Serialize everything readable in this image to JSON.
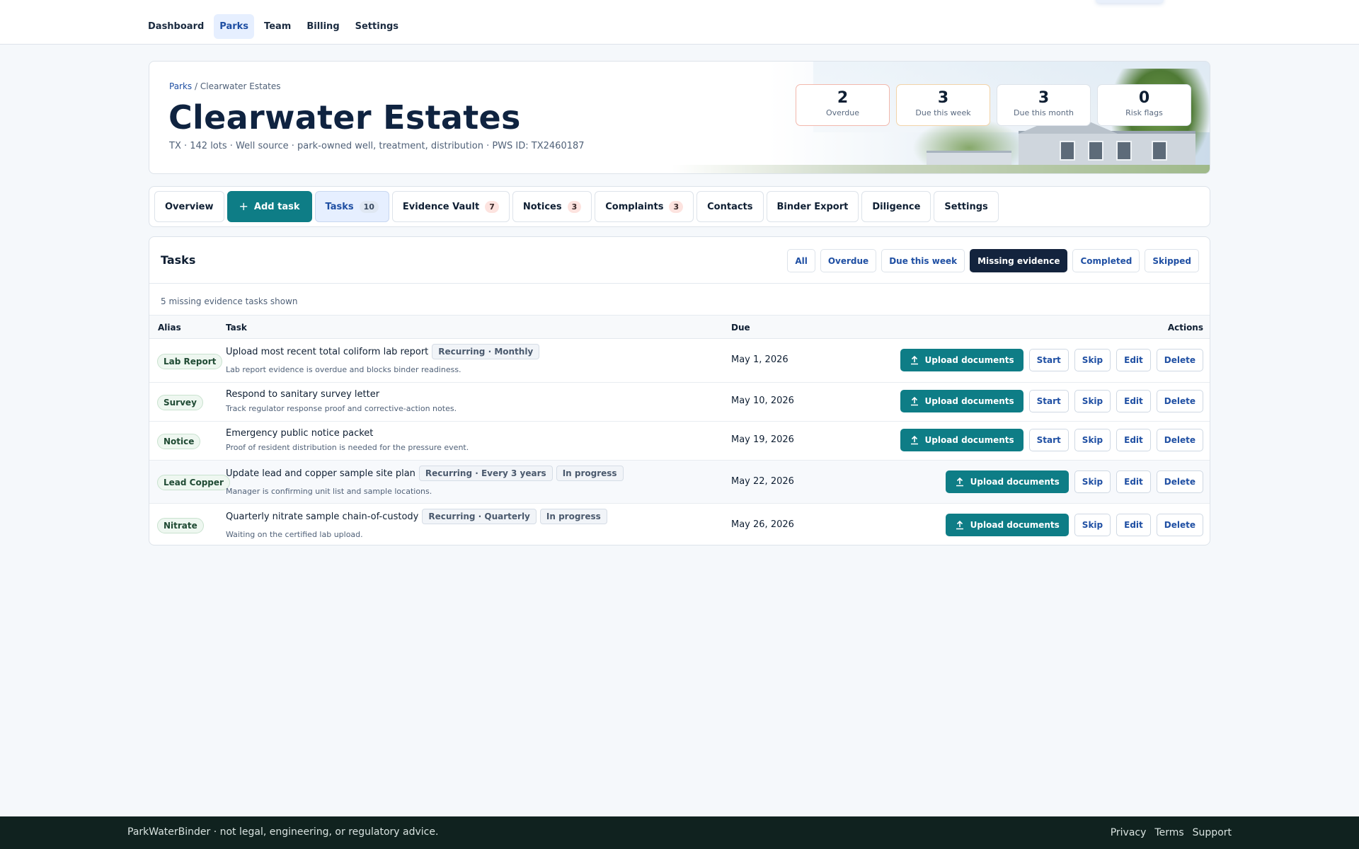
{
  "nav": {
    "items": [
      {
        "label": "Dashboard",
        "active": false
      },
      {
        "label": "Parks",
        "active": true
      },
      {
        "label": "Team",
        "active": false
      },
      {
        "label": "Billing",
        "active": false
      },
      {
        "label": "Settings",
        "active": false
      }
    ]
  },
  "hero": {
    "breadcrumb": {
      "root": "Parks",
      "sep": "/",
      "current": "Clearwater Estates"
    },
    "title": "Clearwater Estates",
    "meta": "TX · 142 lots · Well source · park-owned well, treatment, distribution · PWS ID: TX2460187",
    "stats": [
      {
        "value": "2",
        "label": "Overdue"
      },
      {
        "value": "3",
        "label": "Due this week"
      },
      {
        "value": "3",
        "label": "Due this month"
      },
      {
        "value": "0",
        "label": "Risk flags"
      }
    ]
  },
  "tabs": {
    "overview": "Overview",
    "add_task": "Add task",
    "tasks": {
      "label": "Tasks",
      "badge": "10"
    },
    "evidence": {
      "label": "Evidence Vault",
      "badge": "7"
    },
    "notices": {
      "label": "Notices",
      "badge": "3"
    },
    "complaints": {
      "label": "Complaints",
      "badge": "3"
    },
    "contacts": "Contacts",
    "binder": "Binder Export",
    "diligence": "Diligence",
    "settings": "Settings"
  },
  "tasks_panel": {
    "title": "Tasks",
    "filters": [
      "All",
      "Overdue",
      "Due this week",
      "Missing evidence",
      "Completed",
      "Skipped"
    ],
    "active_filter": "Missing evidence",
    "count_text": "5 missing evidence tasks shown",
    "columns": {
      "alias": "Alias",
      "task": "Task",
      "due": "Due",
      "actions": "Actions"
    },
    "action_labels": {
      "upload": "Upload documents",
      "start": "Start",
      "skip": "Skip",
      "edit": "Edit",
      "delete": "Delete"
    },
    "rows": [
      {
        "alias": "Lab Report",
        "title": "Upload most recent total coliform lab report",
        "tags": [
          "Recurring · Monthly"
        ],
        "desc": "Lab report evidence is overdue and blocks binder readiness.",
        "due": "May 1, 2026",
        "has_start": true
      },
      {
        "alias": "Survey",
        "title": "Respond to sanitary survey letter",
        "tags": [],
        "desc": "Track regulator response proof and corrective-action notes.",
        "due": "May 10, 2026",
        "has_start": true
      },
      {
        "alias": "Notice",
        "title": "Emergency public notice packet",
        "tags": [],
        "desc": "Proof of resident distribution is needed for the pressure event.",
        "due": "May 19, 2026",
        "has_start": true
      },
      {
        "alias": "Lead Copper",
        "title": "Update lead and copper sample site plan",
        "tags": [
          "Recurring · Every 3 years",
          "In progress"
        ],
        "desc": "Manager is confirming unit list and sample locations.",
        "due": "May 22, 2026",
        "has_start": false
      },
      {
        "alias": "Nitrate",
        "title": "Quarterly nitrate sample chain-of-custody",
        "tags": [
          "Recurring · Quarterly",
          "In progress"
        ],
        "desc": "Waiting on the certified lab upload.",
        "due": "May 26, 2026",
        "has_start": false
      }
    ]
  },
  "footer": {
    "text": "ParkWaterBinder · not legal, engineering, or regulatory advice.",
    "links": [
      "Privacy",
      "Terms",
      "Support"
    ]
  },
  "colors": {
    "accent": "#0e7d86",
    "nav_active": "#1f4fa3",
    "dark": "#13233d",
    "footer_bg": "#10221f"
  }
}
